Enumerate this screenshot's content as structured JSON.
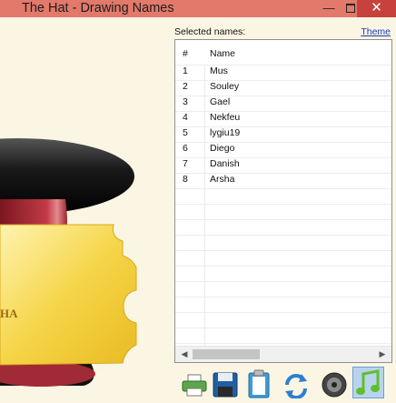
{
  "window": {
    "title": "The Hat - Drawing Names",
    "minimize_glyph": "—",
    "close_glyph": "✕"
  },
  "artwork": {
    "ticket_text": "HA"
  },
  "panel": {
    "selected_label": "Selected names:",
    "theme_link": "Theme",
    "columns": [
      "#",
      "Name"
    ],
    "rows": [
      {
        "num": "1",
        "name": "Mus"
      },
      {
        "num": "2",
        "name": "Souley"
      },
      {
        "num": "3",
        "name": "Gael"
      },
      {
        "num": "4",
        "name": "Nekfeu"
      },
      {
        "num": "5",
        "name": "lygiu19"
      },
      {
        "num": "6",
        "name": "Diego"
      },
      {
        "num": "7",
        "name": "Danish"
      },
      {
        "num": "8",
        "name": "Arsha"
      }
    ],
    "scroll_left_glyph": "◀",
    "scroll_right_glyph": "▶"
  },
  "toolbar": {
    "buttons": [
      {
        "icon": "printer-icon"
      },
      {
        "icon": "save-icon"
      },
      {
        "icon": "clipboard-icon"
      },
      {
        "icon": "refresh-icon"
      },
      {
        "icon": "speaker-icon"
      },
      {
        "icon": "music-note-icon",
        "active": true
      }
    ]
  },
  "colors": {
    "titlebar": "#e2796b",
    "close_button": "#c7423c",
    "background": "#fbf6e3",
    "ticket": "#f2cd3c",
    "hat_band": "#c33b47",
    "link": "#1b3bb5"
  }
}
